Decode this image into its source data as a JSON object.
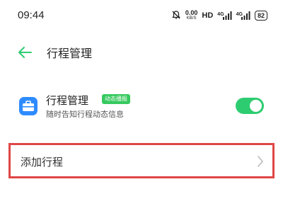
{
  "status_bar": {
    "time": "09:44",
    "speed_value": "0.00",
    "speed_unit": "KB/S",
    "hd_label": "HD",
    "net_label_1": "4G",
    "net_label_2": "4G",
    "battery": "82"
  },
  "header": {
    "title": "行程管理"
  },
  "setting": {
    "title": "行程管理",
    "badge": "动态播报",
    "description": "随时告知行程动态信息",
    "toggle_on": true
  },
  "add_schedule": {
    "label": "添加行程"
  },
  "colors": {
    "accent_green": "#2ecc71",
    "highlight_red": "#e04646",
    "icon_blue": "#2e8bff"
  }
}
